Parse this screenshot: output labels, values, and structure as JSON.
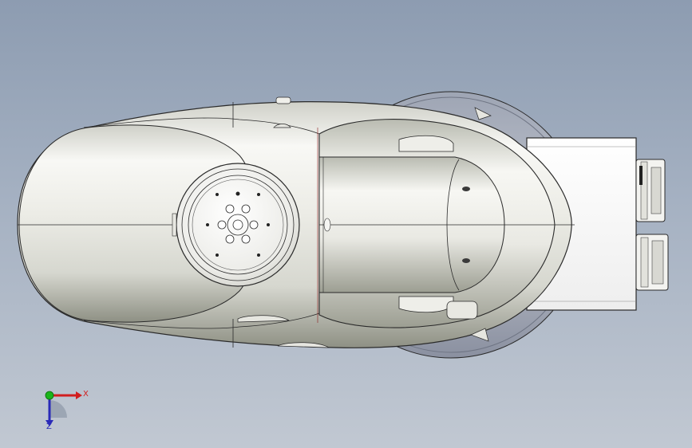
{
  "viewport": {
    "colors": {
      "bg_top": "#8d9cb1",
      "bg_bottom": "#c1c8d2"
    }
  },
  "model": {
    "name": "robot-arm-top-view",
    "colors": {
      "body_light": "#f6f6f3",
      "body_mid": "#dcdcd6",
      "body_dark": "#9a9c90",
      "edge": "#2a2a2a",
      "flange": "#f2f2ee",
      "base_disc": "#8c92a2"
    }
  },
  "triad": {
    "x_label": "X",
    "z_label": "Z",
    "colors": {
      "x_axis": "#d11e1e",
      "y_axis": "#1bb51b",
      "z_axis": "#2a2ab8"
    }
  }
}
